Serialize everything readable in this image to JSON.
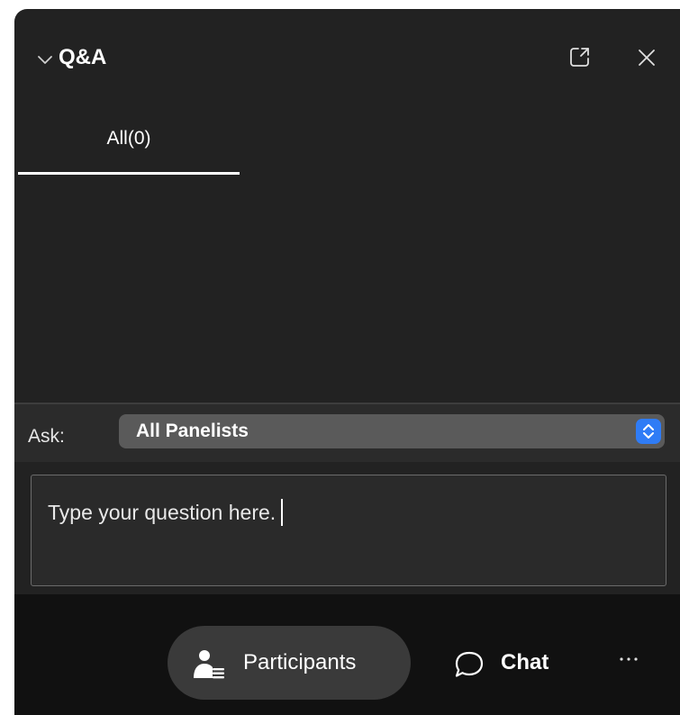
{
  "header": {
    "title": "Q&A",
    "collapse_icon": "chevron-down-icon",
    "popout_icon": "popout-icon",
    "close_icon": "close-icon"
  },
  "tabs": [
    {
      "label": "All(0)",
      "selected": true
    }
  ],
  "ask": {
    "label": "Ask:",
    "selected_value": "All Panelists",
    "stepper_icon": "up-down-stepper-icon"
  },
  "question": {
    "placeholder": "Type your question here."
  },
  "footer": {
    "participants_label": "Participants",
    "participants_icon": "participants-icon",
    "chat_label": "Chat",
    "chat_icon": "chat-bubble-icon",
    "more_label": "···",
    "more_icon": "more-horizontal-icon"
  },
  "colors": {
    "panel_bg": "#222222",
    "footer_bg": "#111111",
    "accent_blue": "#2f7cf6",
    "select_bg": "#5a5a5a",
    "pill_bg": "#3a3a3a"
  }
}
